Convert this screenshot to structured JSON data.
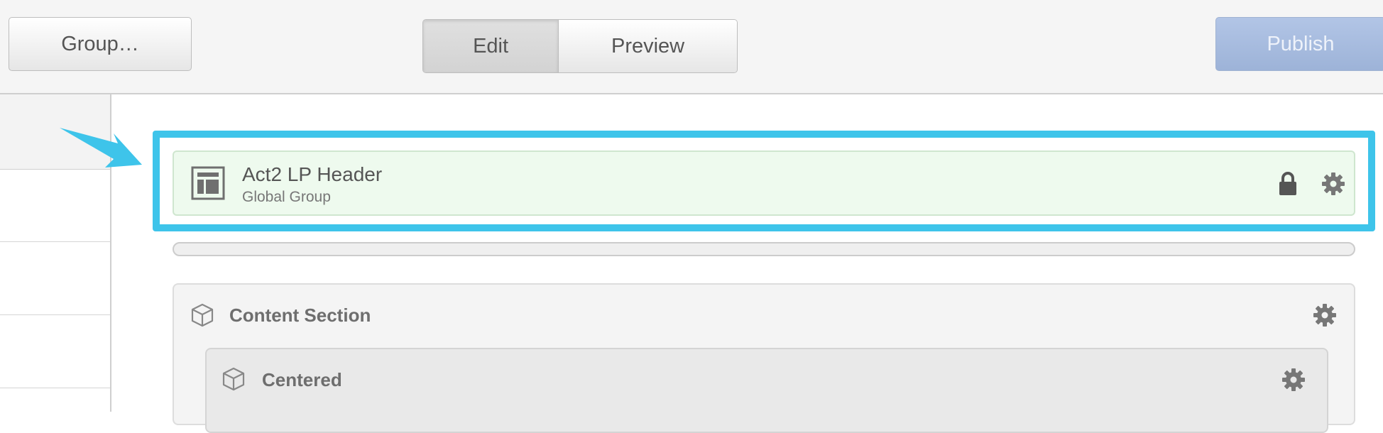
{
  "toolbar": {
    "group_label": "Group…",
    "edit_label": "Edit",
    "preview_label": "Preview",
    "publish_label": "Publish"
  },
  "header_block": {
    "title": "Act2 LP Header",
    "subtitle": "Global Group",
    "icon": "layout-icon",
    "lock_icon": "lock-icon",
    "settings_icon": "gear-icon"
  },
  "content_section": {
    "title": "Content Section",
    "icon": "cube-icon",
    "settings_icon": "gear-icon",
    "child": {
      "title": "Centered",
      "icon": "cube-icon",
      "settings_icon": "gear-icon"
    }
  },
  "colors": {
    "highlight": "#3ec4ea",
    "publish_bg": "#a9bde0",
    "header_bg": "#eefaee"
  }
}
